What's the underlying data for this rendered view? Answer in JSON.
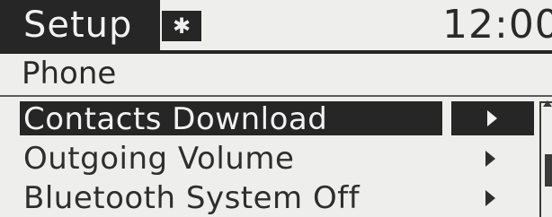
{
  "header": {
    "title": "Setup",
    "bluetooth_icon": "bluetooth-icon",
    "clock": "12:00"
  },
  "section": {
    "title": "Phone"
  },
  "menu": {
    "items": [
      {
        "label": "Contacts Download",
        "selected": true,
        "icon": "chevron-right-icon"
      },
      {
        "label": "Outgoing Volume",
        "selected": false,
        "icon": "chevron-right-icon"
      },
      {
        "label": "Bluetooth System Off",
        "selected": false,
        "icon": "chevron-right-icon"
      }
    ]
  },
  "colors": {
    "screen_bg": "#eeeeec",
    "dark": "#262626",
    "text": "#2e2e2e",
    "highlight_text": "#f2f2f2"
  }
}
